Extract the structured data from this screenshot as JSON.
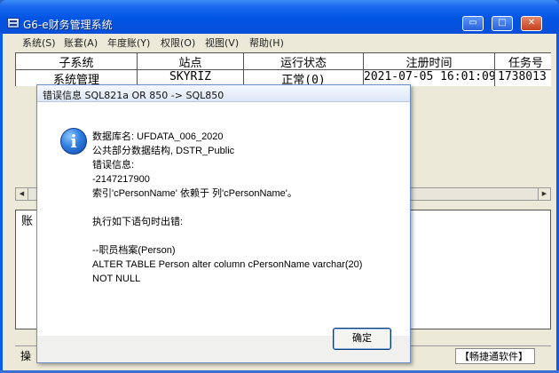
{
  "window": {
    "title": "G6-e财务管理系统",
    "controls": {
      "minimize": "▭",
      "maximize": "□",
      "close": "✕"
    }
  },
  "menu": [
    "系统(S)",
    "账套(A)",
    "年度账(Y)",
    "权限(O)",
    "视图(V)",
    "帮助(H)"
  ],
  "grid": {
    "columns": [
      "子系统",
      "站点",
      "运行状态",
      "注册时间",
      "任务号"
    ],
    "rows": [
      [
        "系统管理",
        "SKYRIZ",
        "正常(0)",
        "2021-07-05 16:01:09",
        "1738013"
      ]
    ]
  },
  "scrollbar": {
    "left_arrow": "◀",
    "right_arrow": "▶"
  },
  "lower_panel": {
    "label": "账"
  },
  "statusbar": {
    "left": "操",
    "right": "【畅捷通软件】"
  },
  "dialog": {
    "title": "错误信息  SQL821a OR 850 -> SQL850",
    "icon": "i",
    "lines": [
      "数据库名: UFDATA_006_2020",
      "公共部分数据结构, DSTR_Public",
      "错误信息:",
      "-2147217900",
      "索引'cPersonName' 依赖于 列'cPersonName'。",
      "",
      "执行如下语句时出错:",
      "",
      "--职员档案(Person)",
      "ALTER TABLE Person alter column cPersonName varchar(20)",
      "NOT NULL"
    ],
    "ok_label": "确定"
  }
}
